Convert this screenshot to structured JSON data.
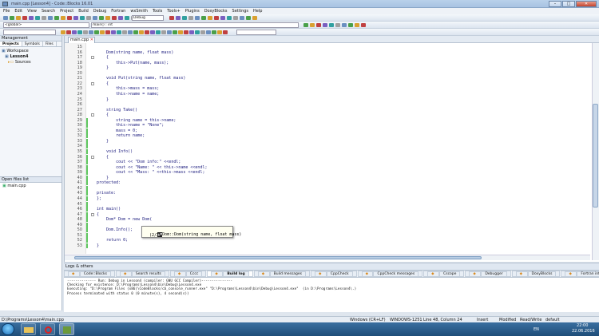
{
  "window": {
    "title": "main.cpp [Lesson4] - Code::Blocks 16.01"
  },
  "menu": [
    "File",
    "Edit",
    "View",
    "Search",
    "Project",
    "Build",
    "Debug",
    "Fortran",
    "wxSmith",
    "Tools",
    "Tools+",
    "Plugins",
    "DoxyBlocks",
    "Settings",
    "Help"
  ],
  "toolbar": {
    "target": "Debug",
    "scope": "<global>",
    "symbol": "main() : int"
  },
  "management": {
    "title": "Management",
    "tabs": [
      "Projects",
      "Symbols",
      "Files"
    ],
    "tree": [
      "Workspace",
      "Lesson4",
      "Sources"
    ]
  },
  "openfiles": {
    "title": "Open files list",
    "items": [
      "main.cpp"
    ]
  },
  "editor": {
    "tab": "main.cpp",
    "lines": [
      {
        "n": "15",
        "t": ""
      },
      {
        "n": "16",
        "t": "    Dom(string name, float mass)"
      },
      {
        "n": "17",
        "t": "    {"
      },
      {
        "n": "18",
        "t": "        this->Put(name, mass);"
      },
      {
        "n": "19",
        "t": "    }"
      },
      {
        "n": "20",
        "t": ""
      },
      {
        "n": "21",
        "t": "    void Put(string name, float mass)"
      },
      {
        "n": "22",
        "t": "    {"
      },
      {
        "n": "23",
        "t": "        this->mass = mass;"
      },
      {
        "n": "24",
        "t": "        this->name = name;"
      },
      {
        "n": "25",
        "t": "    }"
      },
      {
        "n": "26",
        "t": ""
      },
      {
        "n": "27",
        "t": "    string Take()"
      },
      {
        "n": "28",
        "t": "    {"
      },
      {
        "n": "29",
        "t": "        string name = this->name;"
      },
      {
        "n": "30",
        "t": "        this->name = \"None\";"
      },
      {
        "n": "31",
        "t": "        mass = 0;"
      },
      {
        "n": "32",
        "t": "        return name;"
      },
      {
        "n": "33",
        "t": "    }"
      },
      {
        "n": "34",
        "t": ""
      },
      {
        "n": "35",
        "t": "    void Info()"
      },
      {
        "n": "36",
        "t": "    {"
      },
      {
        "n": "37",
        "t": "        cout << \"Dom info:\" <<endl;"
      },
      {
        "n": "38",
        "t": "        cout << \"Name: \" << this->name <<endl;"
      },
      {
        "n": "39",
        "t": "        cout << \"Mass: \" <<this->mass <<endl;"
      },
      {
        "n": "40",
        "t": "    }"
      },
      {
        "n": "41",
        "t": "protected:"
      },
      {
        "n": "42",
        "t": ""
      },
      {
        "n": "43",
        "t": "private:"
      },
      {
        "n": "44",
        "t": "};"
      },
      {
        "n": "45",
        "t": ""
      },
      {
        "n": "46",
        "t": "int main()"
      },
      {
        "n": "47",
        "t": "{"
      },
      {
        "n": "48",
        "t": "    Dom* Dom = new Dom("
      },
      {
        "n": "49",
        "t": ""
      },
      {
        "n": "50",
        "t": "    Dom.Info();"
      },
      {
        "n": "51",
        "t": ""
      },
      {
        "n": "52",
        "t": "    return 0;"
      },
      {
        "n": "53",
        "t": "}"
      }
    ],
    "tooltip_sig": "Dom::Dom(string name, float mass)",
    "tooltip_count": "(2/2)"
  },
  "logs": {
    "title": "Logs & others",
    "tabs": [
      "Code::Blocks",
      "Search results",
      "Cccc",
      "Build log",
      "Build messages",
      "CppCheck",
      "CppCheck messages",
      "Cscope",
      "Debugger",
      "DoxyBlocks",
      "Fortran info",
      "Closed files list",
      "Thread search"
    ],
    "active": "Build log",
    "lines": [
      "-------------- Run: Debug in Lesson4 (compiler: GNU GCC Compiler)---------------",
      "Checking for existence: D:\\Programs\\Lesson4\\bin\\Debug\\Lesson4.exe",
      "Executing: \"D:\\Program Files (x86)\\CodeBlocks/cb_console_runner.exe\" \"D:\\Programs\\Lesson4\\bin\\Debug\\Lesson4.exe\"  (in D:\\Programs\\Lesson4\\.)",
      "Process terminated with status 0 (0 minute(s), 4 second(s))"
    ]
  },
  "status": {
    "path": "D:\\Programs\\Lesson4\\main.cpp",
    "eol": "Windows (CR+LF)",
    "enc": "WINDOWS-1251",
    "pos": "Line 48, Column 24",
    "mode": "Insert",
    "mod": "Modified",
    "rw": "Read/Write",
    "profile": "default"
  },
  "taskbar": {
    "lang": "EN",
    "time": "22:00",
    "date": "22.06.2016"
  }
}
